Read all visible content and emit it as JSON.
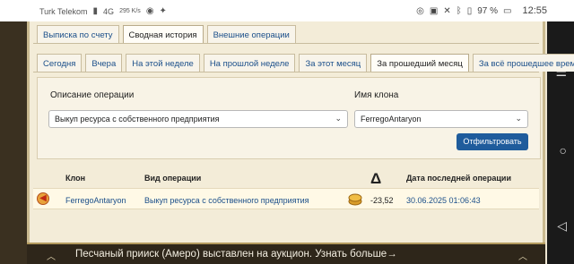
{
  "status_bar": {
    "carrier": "Turk Telekom",
    "net": "4G",
    "speed": "295 K/s",
    "battery": "97 %",
    "time": "12:55"
  },
  "top_tabs": [
    {
      "label": "Выписка по счету",
      "active": false
    },
    {
      "label": "Сводная история",
      "active": true
    },
    {
      "label": "Внешние операции",
      "active": false
    }
  ],
  "period_tabs": [
    {
      "label": "Сегодня",
      "active": false
    },
    {
      "label": "Вчера",
      "active": false
    },
    {
      "label": "На этой неделе",
      "active": false
    },
    {
      "label": "На прошлой неделе",
      "active": false
    },
    {
      "label": "За этот месяц",
      "active": false
    },
    {
      "label": "За прошедший месяц",
      "active": true
    },
    {
      "label": "За всё прошедшее время",
      "active": false
    }
  ],
  "filter": {
    "operation_label": "Описание операции",
    "operation_value": "Выкуп ресурса с собственного предприятия",
    "clone_label": "Имя клона",
    "clone_value": "FerregoAntaryon",
    "button": "Отфильтровать"
  },
  "table": {
    "headers": {
      "clone": "Клон",
      "operation": "Вид операции",
      "delta": "Δ",
      "last_date": "Дата последней операции"
    },
    "rows": [
      {
        "clone": "FerregoAntaryon",
        "operation": "Выкуп ресурса с собственного предприятия",
        "delta": "-23,52",
        "date": "30.06.2025 01:06:43"
      }
    ]
  },
  "banner": {
    "text": "Песчаный прииск (Амеро) выставлен на аукцион. Узнать больше→"
  }
}
